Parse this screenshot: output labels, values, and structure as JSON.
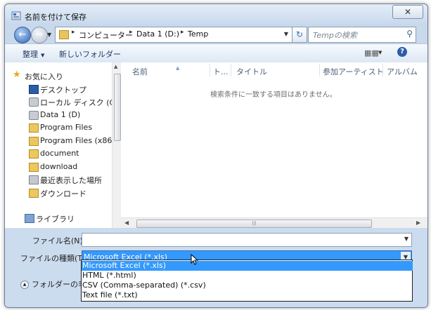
{
  "window": {
    "title": "名前を付けて保存",
    "close_label": "✕"
  },
  "nav": {
    "back_icon": "back-arrow-icon",
    "forward_icon": "forward-arrow-icon",
    "sep": "▸",
    "breadcrumbs": [
      "コンピューター",
      "Data 1 (D:)",
      "Temp"
    ],
    "search_placeholder": "Tempの検索"
  },
  "toolbar": {
    "organize_label": "整理",
    "new_folder_label": "新しいフォルダー"
  },
  "sidebar": {
    "items": [
      {
        "label": "お気に入り",
        "icon": "star-icon"
      },
      {
        "label": "デスクトップ",
        "icon": "desktop-icon"
      },
      {
        "label": "ローカル ディスク (C)",
        "icon": "disk-icon"
      },
      {
        "label": "Data 1 (D)",
        "icon": "drive-icon"
      },
      {
        "label": "Program Files",
        "icon": "folder-icon"
      },
      {
        "label": "Program Files (x86)",
        "icon": "folder-icon"
      },
      {
        "label": "document",
        "icon": "folder-icon"
      },
      {
        "label": "download",
        "icon": "folder-icon"
      },
      {
        "label": "最近表示した場所",
        "icon": "recent-places-icon"
      },
      {
        "label": "ダウンロード",
        "icon": "downloads-icon"
      },
      {
        "label": "ライブラリ",
        "icon": "library-icon"
      }
    ]
  },
  "filelist": {
    "columns": [
      "名前",
      "ト...",
      "タイトル",
      "参加アーティスト",
      "アルバム"
    ],
    "empty_message": "検索条件に一致する項目はありません。"
  },
  "form": {
    "filename_label": "ファイル名(N):",
    "filename_value": "",
    "filetype_label": "ファイルの種類(T):",
    "filetype_value": "Microsoft Excel (*.xls)",
    "filetype_options": [
      "Microsoft Excel (*.xls)",
      "HTML (*.html)",
      "CSV (Comma-separated) (*.csv)",
      "Text file (*.txt)"
    ],
    "selected_option_index": 0,
    "hide_folders_label": "フォルダーの非表"
  },
  "colors": {
    "selection": "#3399ff",
    "window_frame": "#c9d9ec"
  }
}
